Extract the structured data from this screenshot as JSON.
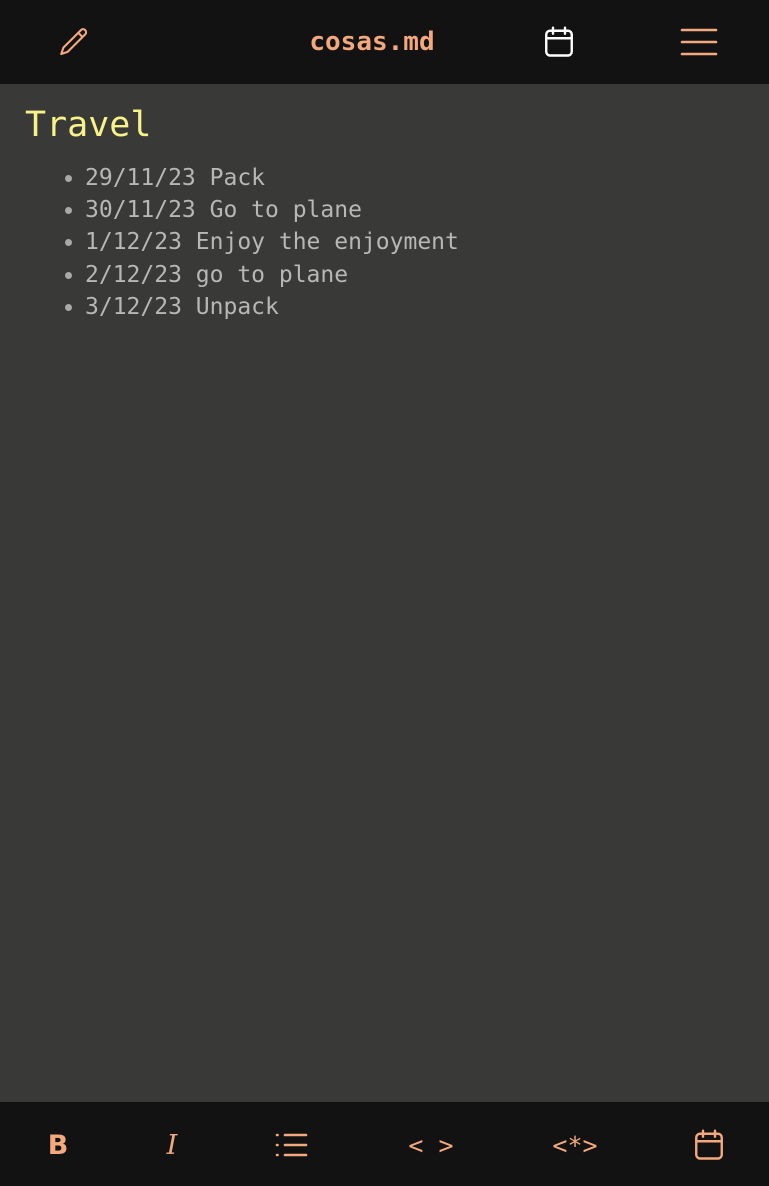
{
  "header": {
    "title": "cosas.md",
    "icons": {
      "edit": "pencil-icon",
      "calendar": "calendar-icon",
      "menu": "hamburger-menu-icon"
    }
  },
  "document": {
    "heading": "Travel",
    "items": [
      "29/11/23 Pack",
      "30/11/23 Go to plane",
      "1/12/23 Enjoy the enjoyment",
      "2/12/23 go to plane",
      "3/12/23 Unpack"
    ]
  },
  "toolbar": {
    "bold_label": "B",
    "italic_label": "I",
    "code_label": "< >",
    "codeblock_label": "<*>",
    "icons": {
      "list": "bullet-list-icon",
      "calendar": "calendar-icon"
    }
  },
  "colors": {
    "accent": "#f3a87d",
    "heading": "#f7f28a",
    "text": "#b7b7b3",
    "background": "#393937",
    "bar": "#121212",
    "white_icon": "#ffffff"
  }
}
